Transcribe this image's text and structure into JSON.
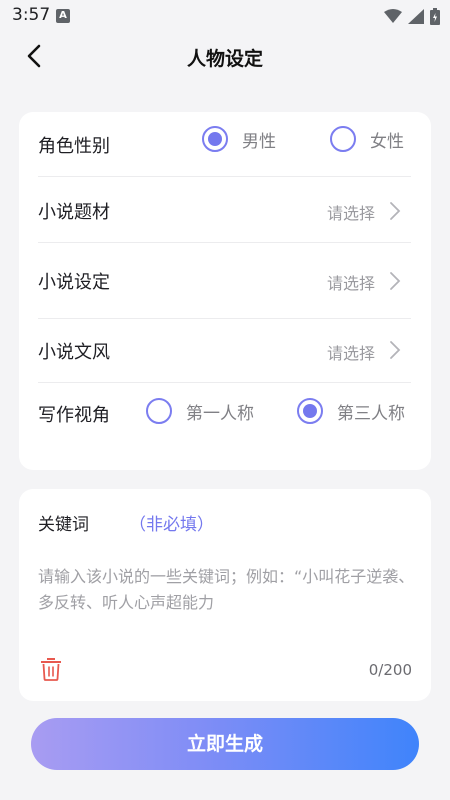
{
  "status_bar": {
    "time": "3:57",
    "app_icon": "A",
    "icons": [
      "wifi-icon",
      "signal-icon",
      "battery-icon"
    ]
  },
  "header": {
    "title": "人物设定",
    "back_icon": "chevron-left-icon"
  },
  "form": {
    "gender": {
      "label": "角色性别",
      "options": [
        {
          "label": "男性",
          "selected": true
        },
        {
          "label": "女性",
          "selected": false
        }
      ]
    },
    "genre": {
      "label": "小说题材",
      "placeholder": "请选择"
    },
    "setting": {
      "label": "小说设定",
      "placeholder": "请选择"
    },
    "style": {
      "label": "小说文风",
      "placeholder": "请选择"
    },
    "perspective": {
      "label": "写作视角",
      "options": [
        {
          "label": "第一人称",
          "selected": false
        },
        {
          "label": "第三人称",
          "selected": true
        }
      ]
    }
  },
  "keywords": {
    "title": "关键词",
    "optional": "（非必填）",
    "placeholder": "请输入该小说的一些关键词；例如：“小叫花子逆袭、多反转、听人心声超能力",
    "count": "0/200"
  },
  "actions": {
    "generate_label": "立即生成"
  },
  "colors": {
    "accent": "#7478ee",
    "delete": "#e8594f",
    "button_gradient_start": "#a89cf2",
    "button_gradient_end": "#3f84fb"
  }
}
